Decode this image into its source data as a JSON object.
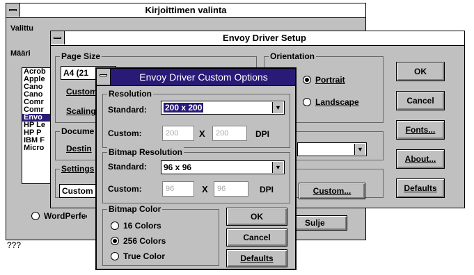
{
  "back_window": {
    "title": "Kirjoittimen valinta",
    "label_valittu": "Valittu",
    "label_maari": "Määri",
    "printers": [
      "Acrob",
      "Apple",
      "Cano",
      "Cano",
      "Comr",
      "Comr",
      "Envo",
      "HP Le",
      "HP P",
      "IBM F",
      "Micro"
    ],
    "selected_printer_index": 6,
    "radio_wordperfect": "WordPerfect",
    "close_button": "Sulje",
    "status_text": "???"
  },
  "setup_window": {
    "title": "Envoy Driver Setup",
    "page_size": {
      "group_label": "Page Size",
      "value": "A4 (21",
      "custom_label": "Custom",
      "scaling_label": "Scaling"
    },
    "document": {
      "group_label": "Docume",
      "destination_label": "Destin"
    },
    "settings": {
      "group_label": "Settings",
      "value": "Custom"
    },
    "orientation": {
      "group_label": "Orientation",
      "portrait": "Portrait",
      "landscape": "Landscape",
      "selected": "portrait"
    },
    "custom_button": "Custom...",
    "buttons": {
      "ok": "OK",
      "cancel": "Cancel",
      "fonts": "Fonts...",
      "about": "About...",
      "defaults": "Defaults"
    }
  },
  "custom_window": {
    "title": "Envoy Driver Custom Options",
    "resolution": {
      "group_label": "Resolution",
      "standard_label": "Standard:",
      "standard_value": "200 x 200",
      "custom_label": "Custom:",
      "custom_x": "200",
      "times": "X",
      "custom_y": "200",
      "unit": "DPI"
    },
    "bitmap_resolution": {
      "group_label": "Bitmap Resolution",
      "standard_label": "Standard:",
      "standard_value": "96 x 96",
      "custom_label": "Custom:",
      "custom_x": "96",
      "times": "X",
      "custom_y": "96",
      "unit": "DPI"
    },
    "bitmap_color": {
      "group_label": "Bitmap Color",
      "options": [
        "16 Colors",
        "256 Colors",
        "True Color"
      ],
      "selected_index": 1
    },
    "buttons": {
      "ok": "OK",
      "cancel": "Cancel",
      "defaults": "Defaults"
    }
  },
  "icons": {
    "system_menu": "system-menu-icon",
    "dropdown": "dropdown-arrow-icon",
    "radio": "radio-icon"
  },
  "colors": {
    "title_active": "#2a1a78",
    "window_bg": "#c0c0c0",
    "selection": "#2a1a78"
  }
}
